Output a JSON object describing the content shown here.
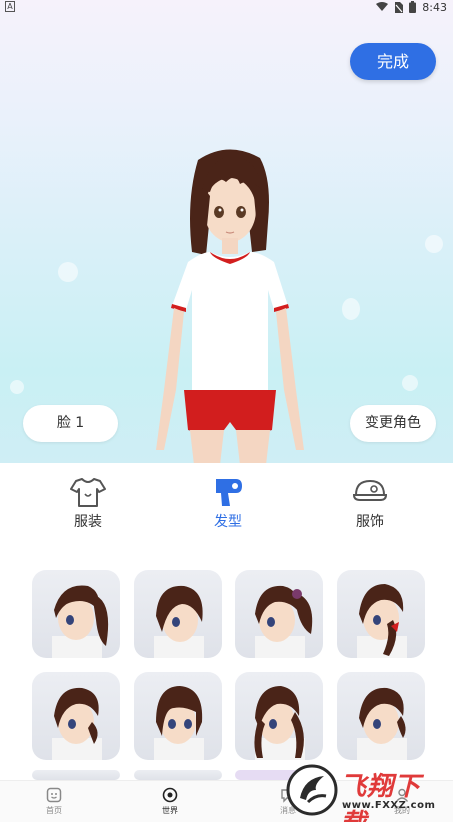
{
  "status_bar": {
    "left_icon_letter": "A",
    "time": "8:43",
    "icons": [
      "wifi-icon",
      "sim-icon",
      "battery-icon"
    ]
  },
  "editor": {
    "done_label": "完成",
    "face_label": "脸 1",
    "change_role_label": "变更角色"
  },
  "categories": {
    "items": [
      {
        "label": "服装",
        "icon": "shirt-icon",
        "active": false
      },
      {
        "label": "发型",
        "icon": "hair-dryer-icon",
        "active": true
      },
      {
        "label": "服饰",
        "icon": "cap-icon",
        "active": false
      }
    ]
  },
  "hairstyles": {
    "count_visible": 8,
    "styles": [
      "side-ponytail",
      "short-bob",
      "twin-tails-bow",
      "side-braid-ribbon",
      "low-tail",
      "straight-bob",
      "long-twin-tails",
      "short-curl"
    ]
  },
  "bottom_nav": {
    "items": [
      {
        "label": "首页",
        "icon": "home-face-icon"
      },
      {
        "label": "世界",
        "icon": "target-icon",
        "active": true
      },
      {
        "label": "消息",
        "icon": "message-icon"
      },
      {
        "label": "我的",
        "icon": "profile-icon"
      }
    ]
  },
  "watermark": {
    "brand": "飞翔下载",
    "url": "www.FXXZ.com"
  },
  "colors": {
    "accent": "#2f6fe4",
    "watermark_red": "#e03a3a",
    "hair": "#4a2418"
  }
}
